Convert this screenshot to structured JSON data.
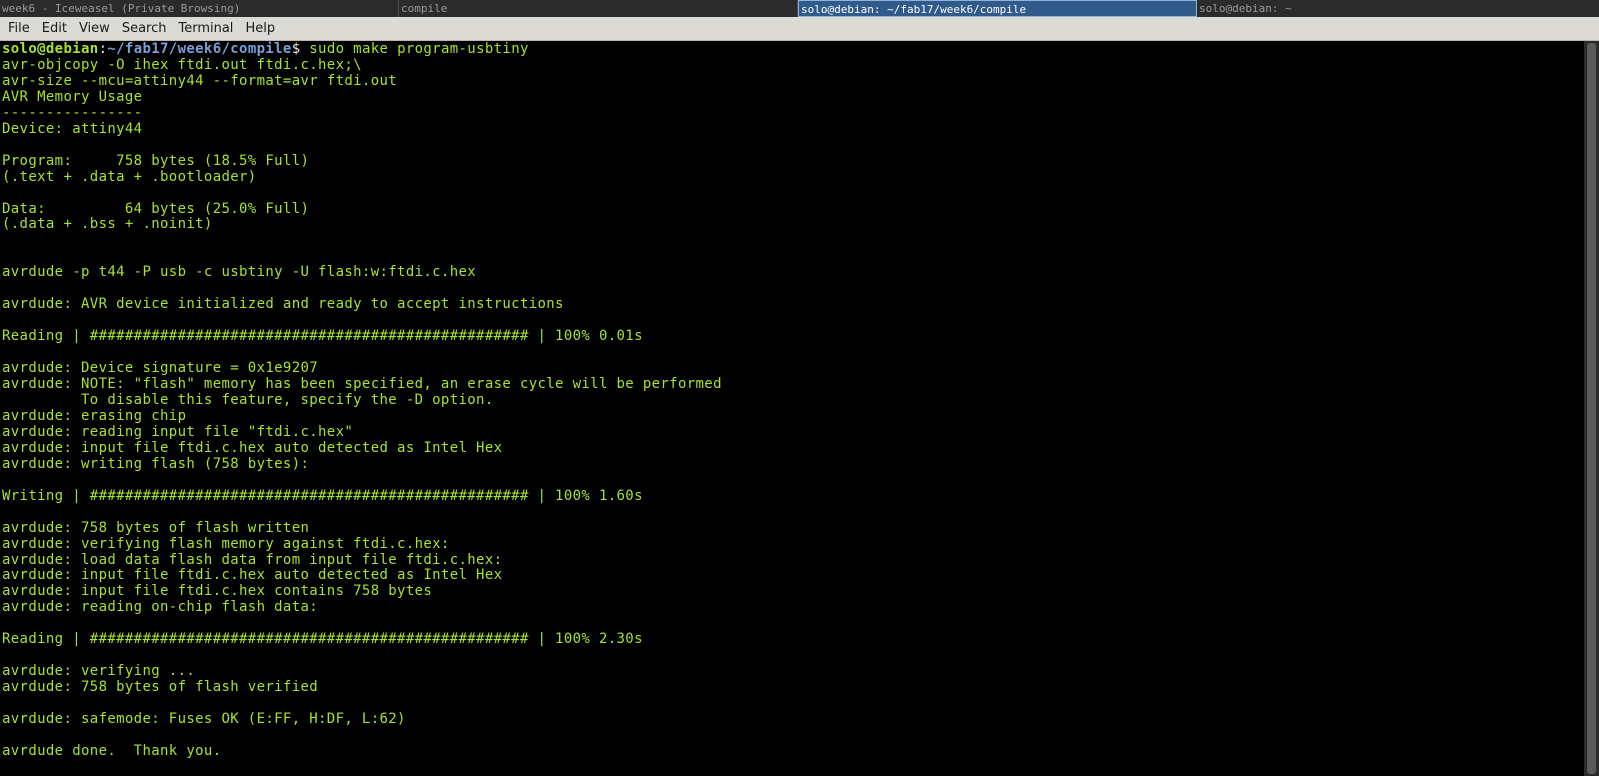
{
  "wm_tabs": [
    {
      "label": "week6 - Iceweasel (Private Browsing)",
      "active": false
    },
    {
      "label": "compile",
      "active": false
    },
    {
      "label": "solo@debian: ~/fab17/week6/compile",
      "active": true
    },
    {
      "label": "solo@debian: ~",
      "active": false
    }
  ],
  "menu": [
    "File",
    "Edit",
    "View",
    "Search",
    "Terminal",
    "Help"
  ],
  "prompt": {
    "user_host": "solo@debian",
    "sep": ":",
    "path": "~/fab17/week6/compile",
    "symbol": "$",
    "command": " sudo make program-usbtiny"
  },
  "output_lines": [
    "avr-objcopy -O ihex ftdi.out ftdi.c.hex;\\",
    "avr-size --mcu=attiny44 --format=avr ftdi.out",
    "AVR Memory Usage",
    "----------------",
    "Device: attiny44",
    "",
    "Program:     758 bytes (18.5% Full)",
    "(.text + .data + .bootloader)",
    "",
    "Data:         64 bytes (25.0% Full)",
    "(.data + .bss + .noinit)",
    "",
    "",
    "avrdude -p t44 -P usb -c usbtiny -U flash:w:ftdi.c.hex",
    "",
    "avrdude: AVR device initialized and ready to accept instructions",
    "",
    "Reading | ################################################## | 100% 0.01s",
    "",
    "avrdude: Device signature = 0x1e9207",
    "avrdude: NOTE: \"flash\" memory has been specified, an erase cycle will be performed",
    "         To disable this feature, specify the -D option.",
    "avrdude: erasing chip",
    "avrdude: reading input file \"ftdi.c.hex\"",
    "avrdude: input file ftdi.c.hex auto detected as Intel Hex",
    "avrdude: writing flash (758 bytes):",
    "",
    "Writing | ################################################## | 100% 1.60s",
    "",
    "avrdude: 758 bytes of flash written",
    "avrdude: verifying flash memory against ftdi.c.hex:",
    "avrdude: load data flash data from input file ftdi.c.hex:",
    "avrdude: input file ftdi.c.hex auto detected as Intel Hex",
    "avrdude: input file ftdi.c.hex contains 758 bytes",
    "avrdude: reading on-chip flash data:",
    "",
    "Reading | ################################################## | 100% 2.30s",
    "",
    "avrdude: verifying ...",
    "avrdude: 758 bytes of flash verified",
    "",
    "avrdude: safemode: Fuses OK (E:FF, H:DF, L:62)",
    "",
    "avrdude done.  Thank you."
  ],
  "colors": {
    "terminal_bg": "#000000",
    "terminal_fg": "#a7e22e",
    "path": "#7b9fd6",
    "active_tab": "#2f5a8a"
  }
}
